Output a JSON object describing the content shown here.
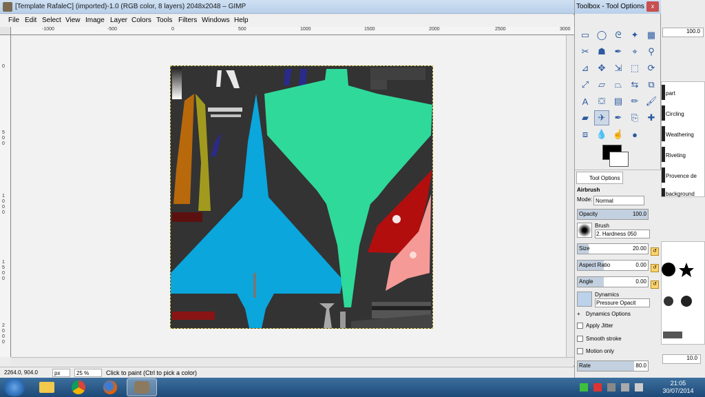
{
  "main_window": {
    "title": "[Template RafaleC] (imported)-1.0 (RGB color, 8 layers) 2048x2048 – GIMP",
    "menu": [
      "File",
      "Edit",
      "Select",
      "View",
      "Image",
      "Layer",
      "Colors",
      "Tools",
      "Filters",
      "Windows",
      "Help"
    ],
    "ruler_top_labels": [
      "-1000",
      "-500",
      "0",
      "500",
      "1000",
      "1500",
      "2000",
      "2500",
      "3000"
    ],
    "ruler_left_labels": [
      "0",
      "5",
      "0",
      "0",
      "1",
      "0",
      "0",
      "0",
      "1",
      "5",
      "0",
      "0",
      "2",
      "0",
      "0",
      "0"
    ],
    "status": {
      "coords": "2264.0, 904.0",
      "unit": "px",
      "zoom": "25 %",
      "message": "Click to paint (Ctrl to pick a color)"
    }
  },
  "toolbox": {
    "title": "Toolbox - Tool Options",
    "close_label": "x",
    "tools": [
      "rect-select",
      "ellipse-select",
      "free-select",
      "fuzzy-select",
      "select-by-color",
      "scissors",
      "foreground-select",
      "paths",
      "color-picker",
      "zoom",
      "measure",
      "move",
      "align",
      "crop",
      "rotate",
      "scale",
      "shear",
      "perspective",
      "flip",
      "cage",
      "text",
      "bucket-fill",
      "blend",
      "pencil",
      "paintbrush",
      "eraser",
      "airbrush",
      "ink",
      "clone",
      "heal",
      "perspective-clone",
      "blur",
      "smudge",
      "dodge-burn"
    ],
    "active_tool_index": 26,
    "fg_color": "#000000",
    "bg_color": "#ffffff"
  },
  "tool_options": {
    "tab_label": "Tool Options",
    "tool_name": "Airbrush",
    "mode_label": "Mode:",
    "mode_value": "Normal",
    "opacity": {
      "label": "Opacity",
      "value": "100.0",
      "fraction": 1.0
    },
    "brush_label": "Brush",
    "brush_value": "2. Hardness 050",
    "size": {
      "label": "Size",
      "value": "20.00"
    },
    "aspect_ratio": {
      "label": "Aspect Ratio",
      "value": "0.00"
    },
    "angle": {
      "label": "Angle",
      "value": "0.00"
    },
    "dynamics_label": "Dynamics",
    "dynamics_value": "Pressure Opacit",
    "dynamics_options": "Dynamics Options",
    "apply_jitter": "Apply Jitter",
    "smooth_stroke": "Smooth stroke",
    "motion_only": "Motion only",
    "rate": {
      "label": "Rate",
      "value": "80.0",
      "fraction": 0.8
    }
  },
  "dock": {
    "value_top": "100.0",
    "layers": [
      "part",
      "Circling",
      "Weathering",
      "Riveting",
      "Provence de",
      "background"
    ],
    "value_bottom": "10.0"
  },
  "taskbar": {
    "time": "21:05",
    "date": "30/07/2014"
  }
}
